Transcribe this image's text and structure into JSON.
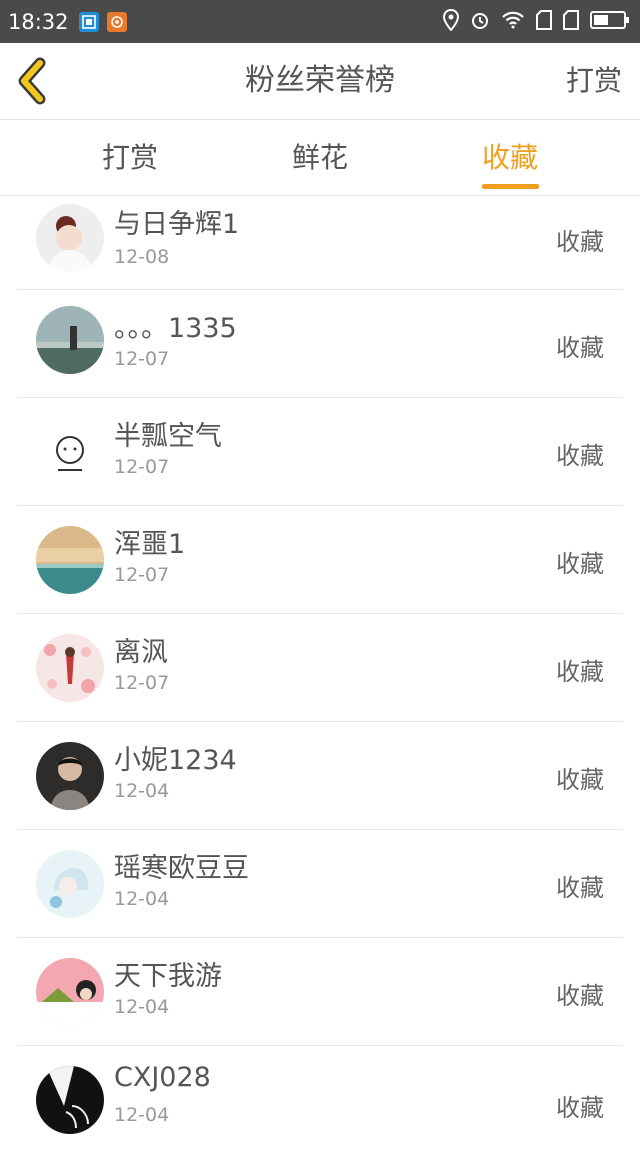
{
  "status_bar": {
    "time": "18:32"
  },
  "header": {
    "title": "粉丝荣誉榜",
    "right_action": "打赏"
  },
  "tabs": [
    {
      "label": "打赏",
      "active": false
    },
    {
      "label": "鲜花",
      "active": false
    },
    {
      "label": "收藏",
      "active": true
    }
  ],
  "accent_color": "#f0a020",
  "list": [
    {
      "name": "与日争辉1",
      "date": "12-08",
      "action": "收藏"
    },
    {
      "name": "。。。1335",
      "date": "12-07",
      "action": "收藏"
    },
    {
      "name": "半瓢空气",
      "date": "12-07",
      "action": "收藏"
    },
    {
      "name": "浑噩1",
      "date": "12-07",
      "action": "收藏"
    },
    {
      "name": "离沨",
      "date": "12-07",
      "action": "收藏"
    },
    {
      "name": "小妮1234",
      "date": "12-04",
      "action": "收藏"
    },
    {
      "name": "瑶寒欧豆豆",
      "date": "12-04",
      "action": "收藏"
    },
    {
      "name": "天下我游",
      "date": "12-04",
      "action": "收藏"
    },
    {
      "name": "CXJ028",
      "date": "12-04",
      "action": "收藏"
    }
  ]
}
